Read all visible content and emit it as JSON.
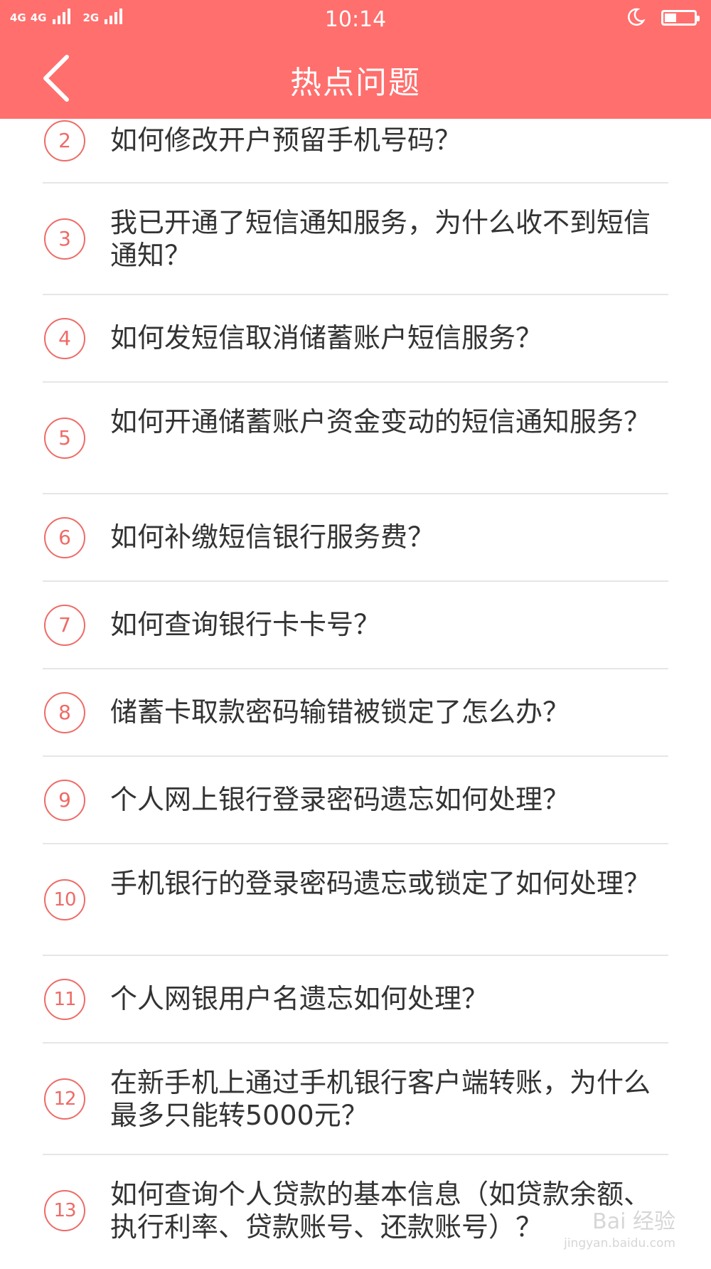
{
  "status_bar": {
    "signal_1": "4G",
    "signal_2": "4G",
    "signal_3": "2G",
    "time": "10:14"
  },
  "header": {
    "title": "热点问题",
    "back_icon": "chevron-left-icon"
  },
  "questions": [
    {
      "num": "2",
      "text": "如何修改开户预留手机号码？"
    },
    {
      "num": "3",
      "text": "我已开通了短信通知服务，为什么收不到短信通知？"
    },
    {
      "num": "4",
      "text": "如何发短信取消储蓄账户短信服务？"
    },
    {
      "num": "5",
      "text": "如何开通储蓄账户资金变动的短信通知服务？"
    },
    {
      "num": "6",
      "text": "如何补缴短信银行服务费？"
    },
    {
      "num": "7",
      "text": "如何查询银行卡卡号？"
    },
    {
      "num": "8",
      "text": "储蓄卡取款密码输错被锁定了怎么办？"
    },
    {
      "num": "9",
      "text": "个人网上银行登录密码遗忘如何处理？"
    },
    {
      "num": "10",
      "text": "手机银行的登录密码遗忘或锁定了如何处理？"
    },
    {
      "num": "11",
      "text": "个人网银用户名遗忘如何处理？"
    },
    {
      "num": "12",
      "text": "在新手机上通过手机银行客户端转账，为什么最多只能转5000元？"
    },
    {
      "num": "13",
      "text": "如何查询个人贷款的基本信息（如贷款余额、执行利率、贷款账号、还款账号）？"
    }
  ],
  "watermark": {
    "main": "Bai 经验",
    "sub": "jingyan.baidu.com"
  },
  "colors": {
    "header_bg": "#ff6f6d",
    "accent": "#ee6b67",
    "text": "#333333",
    "divider": "#e6e6e6"
  }
}
